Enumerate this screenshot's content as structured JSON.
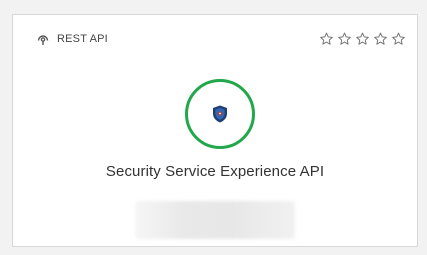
{
  "card": {
    "api_type": "REST API",
    "api_type_icon": "rest-api-icon",
    "rating": {
      "stars_filled": 0,
      "stars_total": 5,
      "star_icon": "star-outline-icon"
    },
    "logo_icon": "shield-icon",
    "logo_ring_color": "#22a84a",
    "name": "Security Service Experience API"
  }
}
